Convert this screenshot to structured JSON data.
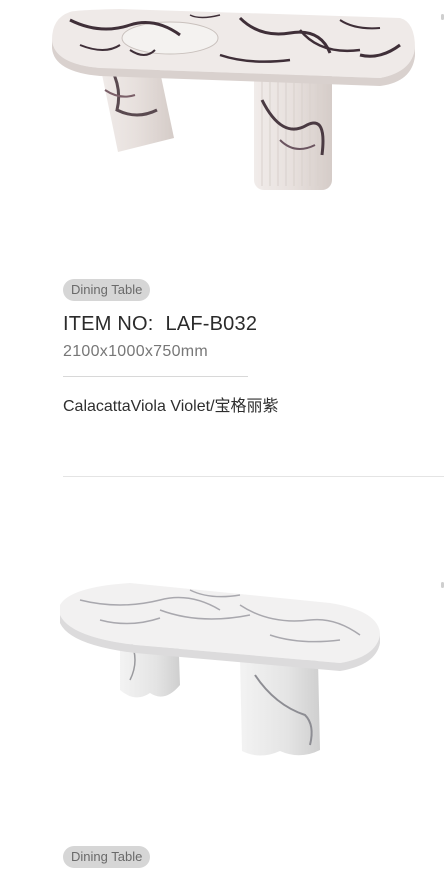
{
  "products": [
    {
      "image_icon": "marble-dining-table-image",
      "category": "Dining Table",
      "item_label": "ITEM NO:",
      "item_code": "LAF-B032",
      "dimensions": "2100x1000x750mm",
      "material": "CalacattaViola Violet/宝格丽紫"
    },
    {
      "image_icon": "white-marble-dining-table-image",
      "category": "Dining Table"
    }
  ]
}
